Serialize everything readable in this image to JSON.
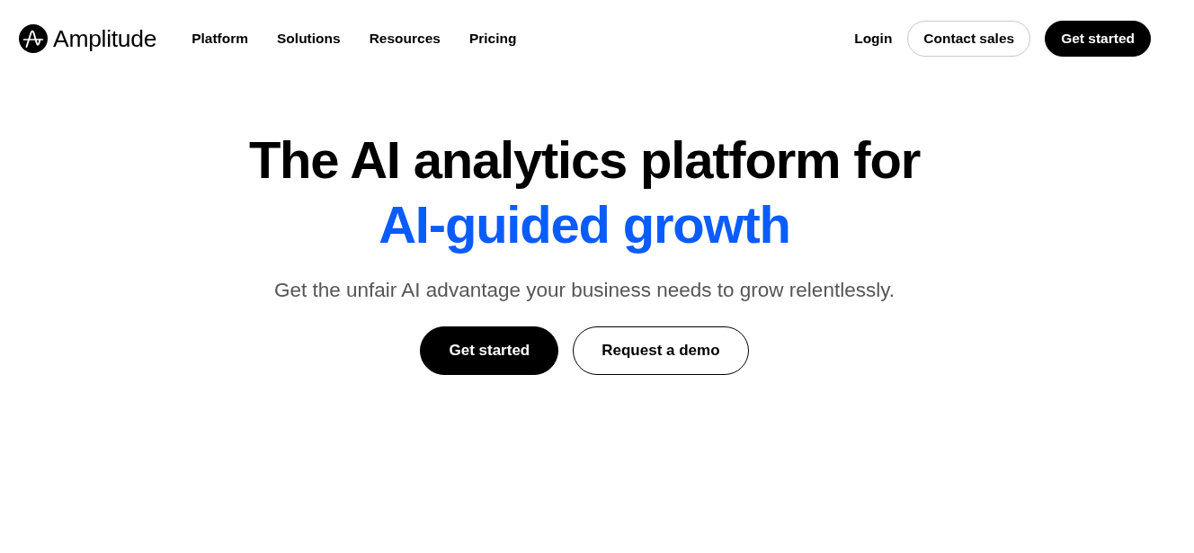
{
  "header": {
    "logo": {
      "wordmark": "Amplitude"
    },
    "nav": [
      {
        "label": "Platform"
      },
      {
        "label": "Solutions"
      },
      {
        "label": "Resources"
      },
      {
        "label": "Pricing"
      }
    ],
    "actions": [
      {
        "kind": "link",
        "label": "Login"
      },
      {
        "kind": "outline",
        "label": "Contact sales"
      },
      {
        "kind": "solid",
        "label": "Get started"
      }
    ]
  },
  "hero": {
    "title": "The AI analytics platform for",
    "highlight": "AI-guided growth",
    "subtitle": "Get the unfair AI advantage your business needs to grow relentlessly.",
    "buttons": [
      {
        "kind": "solid",
        "label": "Get started"
      },
      {
        "kind": "outline",
        "label": "Request a demo"
      }
    ]
  }
}
